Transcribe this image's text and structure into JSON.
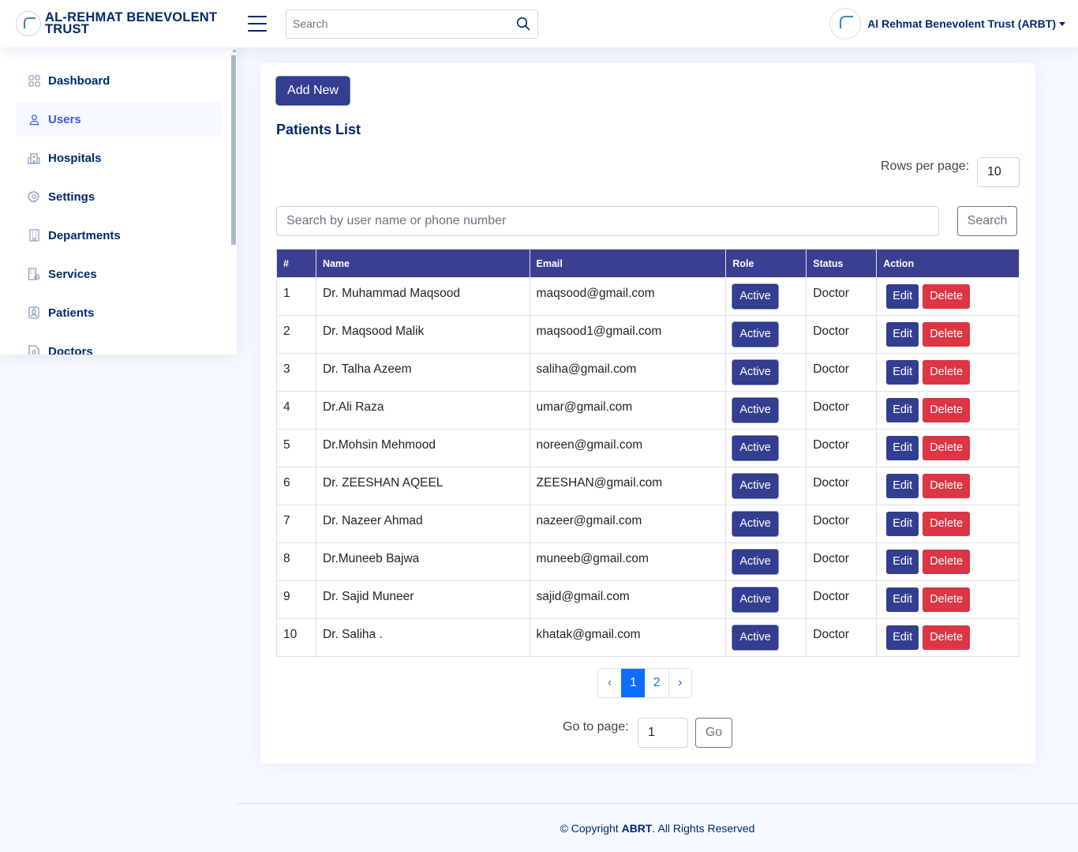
{
  "header": {
    "brand_line1": "AL-REHMAT BENEVOLENT",
    "brand_line2": "TRUST",
    "search_placeholder": "Search",
    "profile_name": "Al Rehmat Benevolent Trust (ARBT)"
  },
  "sidebar": {
    "items": [
      {
        "label": "Dashboard",
        "icon": "grid-icon",
        "active": false
      },
      {
        "label": "Users",
        "icon": "person-icon",
        "active": true
      },
      {
        "label": "Hospitals",
        "icon": "hospital-icon",
        "active": false
      },
      {
        "label": "Settings",
        "icon": "gear-icon",
        "active": false
      },
      {
        "label": "Departments",
        "icon": "building-icon",
        "active": false
      },
      {
        "label": "Services",
        "icon": "building-check-icon",
        "active": false
      },
      {
        "label": "Patients",
        "icon": "person-badge-icon",
        "active": false
      },
      {
        "label": "Doctors",
        "icon": "file-person-icon",
        "active": false
      }
    ]
  },
  "main": {
    "add_button": "Add New",
    "title": "Patients List",
    "rows_per_page_label": "Rows per page:",
    "rows_per_page_value": "10",
    "search_placeholder": "Search by user name or phone number",
    "search_button": "Search",
    "table": {
      "columns": [
        "#",
        "Name",
        "Email",
        "Role",
        "Status",
        "Action"
      ],
      "rows": [
        {
          "num": "1",
          "name": "Dr. Muhammad Maqsood",
          "email": "maqsood@gmail.com",
          "role": "Active",
          "status": "Doctor"
        },
        {
          "num": "2",
          "name": "Dr. Maqsood Malik",
          "email": "maqsood1@gmail.com",
          "role": "Active",
          "status": "Doctor"
        },
        {
          "num": "3",
          "name": "Dr. Talha Azeem",
          "email": "saliha@gmail.com",
          "role": "Active",
          "status": "Doctor"
        },
        {
          "num": "4",
          "name": "Dr.Ali Raza",
          "email": "umar@gmail.com",
          "role": "Active",
          "status": "Doctor"
        },
        {
          "num": "5",
          "name": "Dr.Mohsin Mehmood",
          "email": "noreen@gmail.com",
          "role": "Active",
          "status": "Doctor"
        },
        {
          "num": "6",
          "name": "Dr. ZEESHAN AQEEL",
          "email": "ZEESHAN@gmail.com",
          "role": "Active",
          "status": "Doctor"
        },
        {
          "num": "7",
          "name": "Dr. Nazeer Ahmad",
          "email": "nazeer@gmail.com",
          "role": "Active",
          "status": "Doctor"
        },
        {
          "num": "8",
          "name": "Dr.Muneeb Bajwa",
          "email": "muneeb@gmail.com",
          "role": "Active",
          "status": "Doctor"
        },
        {
          "num": "9",
          "name": "Dr. Sajid Muneer",
          "email": "sajid@gmail.com",
          "role": "Active",
          "status": "Doctor"
        },
        {
          "num": "10",
          "name": "Dr. Saliha .",
          "email": "khatak@gmail.com",
          "role": "Active",
          "status": "Doctor"
        }
      ],
      "edit_label": "Edit",
      "delete_label": "Delete"
    },
    "pagination": {
      "prev": "‹",
      "pages": [
        "1",
        "2"
      ],
      "current": "1",
      "next": "›"
    },
    "goto_label": "Go to page:",
    "goto_value": "1",
    "go_button": "Go"
  },
  "footer": {
    "prefix": "© Copyright",
    "brand": "ABRT",
    "suffix": ". All Rights Reserved"
  },
  "colors": {
    "primary": "#333e91",
    "danger": "#dc3545",
    "nav_text": "#012970",
    "nav_active": "#4154f1",
    "page_active": "#0d6efd"
  }
}
